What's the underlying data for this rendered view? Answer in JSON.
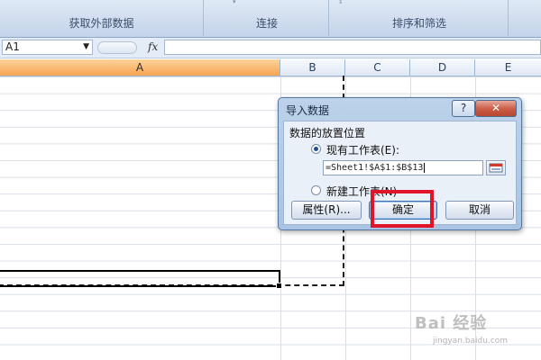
{
  "ribbon": {
    "groups": [
      {
        "label": "获取外部数据"
      },
      {
        "label": "连接"
      },
      {
        "label": "排序和筛选"
      }
    ]
  },
  "formula_bar": {
    "name_box": "A1",
    "fx_label": "fx",
    "formula": ""
  },
  "columns": [
    "A",
    "B",
    "C",
    "D",
    "E"
  ],
  "selected_column": "A",
  "dialog": {
    "title": "导入数据",
    "help_label": "?",
    "close_label": "✕",
    "section_label": "数据的放置位置",
    "option_existing": "现有工作表(E):",
    "reference": "=Sheet1!$A$1:$B$13",
    "option_new": "新建工作表(N)",
    "properties_button": "属性(R)...",
    "ok_button": "确定",
    "cancel_button": "取消",
    "selected_option": "existing"
  },
  "watermark": {
    "text": "Bai 经验",
    "subtext": "jingyan.baidu.com"
  },
  "colors": {
    "highlight": "#e0142b",
    "selected_header": "#f8a453",
    "ribbon": "#cfdcee"
  }
}
